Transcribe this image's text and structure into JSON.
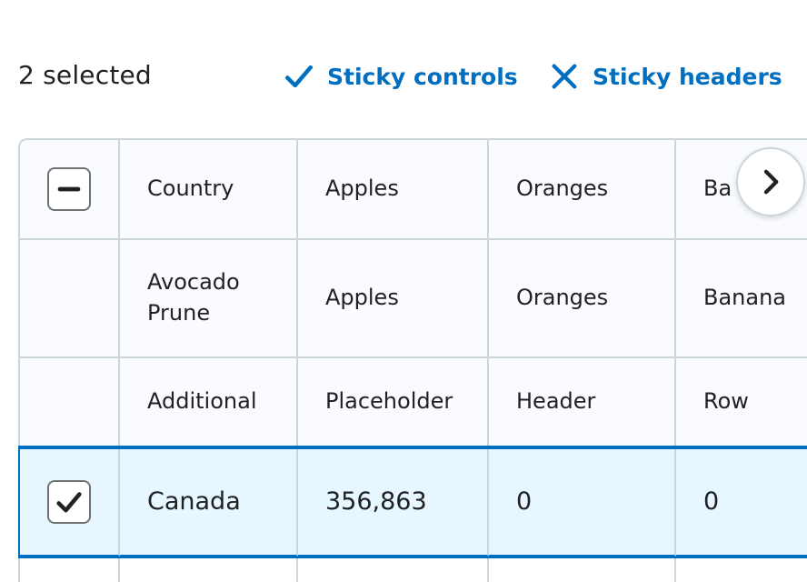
{
  "controls": {
    "selected_count": "2 selected",
    "sticky_controls_label": "Sticky controls",
    "sticky_headers_label": "Sticky headers"
  },
  "table": {
    "header_rows": [
      [
        "Country",
        "Apples",
        "Oranges",
        "Ba"
      ],
      [
        "Avocado Prune",
        "Apples",
        "Oranges",
        "Banana"
      ],
      [
        "Additional",
        "Placeholder",
        "Header",
        "Row"
      ]
    ],
    "body_rows": [
      {
        "selected": true,
        "cells": [
          "Canada",
          "356,863",
          "0",
          "0"
        ]
      }
    ]
  },
  "icons": {
    "check": "check-icon",
    "close": "close-icon",
    "minus": "minus-icon",
    "chevron": "chevron-right-icon"
  },
  "colors": {
    "accent": "#006fbf",
    "selected_row_bg": "#e7f7ff",
    "border": "#cdd5dc"
  }
}
